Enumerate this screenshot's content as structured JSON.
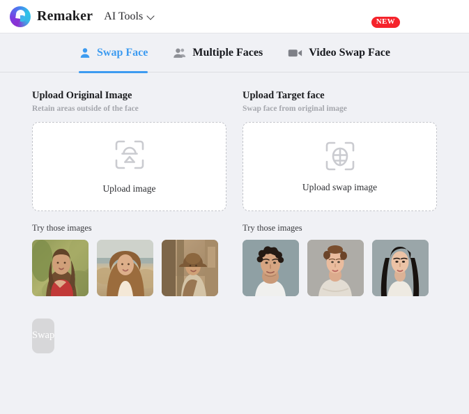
{
  "header": {
    "brand": "Remaker",
    "logo_icon": "remaker-swirl-logo",
    "menu_label": "AI Tools",
    "chevron_icon": "chevron-down-icon"
  },
  "tabs": [
    {
      "id": "swap-face",
      "label": "Swap Face",
      "icon": "person-icon",
      "active": true,
      "badge": ""
    },
    {
      "id": "multiple-faces",
      "label": "Multiple Faces",
      "icon": "people-icon",
      "active": false,
      "badge": ""
    },
    {
      "id": "video-swap",
      "label": "Video Swap Face",
      "icon": "video-camera-icon",
      "active": false,
      "badge": "NEW"
    }
  ],
  "panels": {
    "original": {
      "title": "Upload Original Image",
      "subtitle": "Retain areas outside of the face",
      "dropzone_icon": "face-scan-icon",
      "dropzone_label": "Upload image",
      "try_label": "Try those images",
      "thumbnails": [
        {
          "alt": "woman-in-red-top-garden",
          "name": "sample-original-1"
        },
        {
          "alt": "woman-with-curly-hair-beach",
          "name": "sample-original-2"
        },
        {
          "alt": "man-in-cowboy-hat-western-street",
          "name": "sample-original-3"
        }
      ]
    },
    "target": {
      "title": "Upload Target face",
      "subtitle": "Swap face from original image",
      "dropzone_icon": "face-mesh-scan-icon",
      "dropzone_label": "Upload swap image",
      "try_label": "Try those images",
      "thumbnails": [
        {
          "alt": "man-with-curly-dark-hair-portrait",
          "name": "sample-face-1"
        },
        {
          "alt": "woman-with-auburn-updo-portrait",
          "name": "sample-face-2"
        },
        {
          "alt": "woman-with-long-black-hair-portrait",
          "name": "sample-face-3"
        }
      ]
    }
  },
  "action": {
    "swap_label": "Swap",
    "disabled": true
  },
  "colors": {
    "accent_blue": "#3d9bf0",
    "badge_red": "#f5232b",
    "page_bg": "#f0f1f5",
    "header_bg": "#ffffff",
    "disabled_button": "#d7d7d9"
  }
}
